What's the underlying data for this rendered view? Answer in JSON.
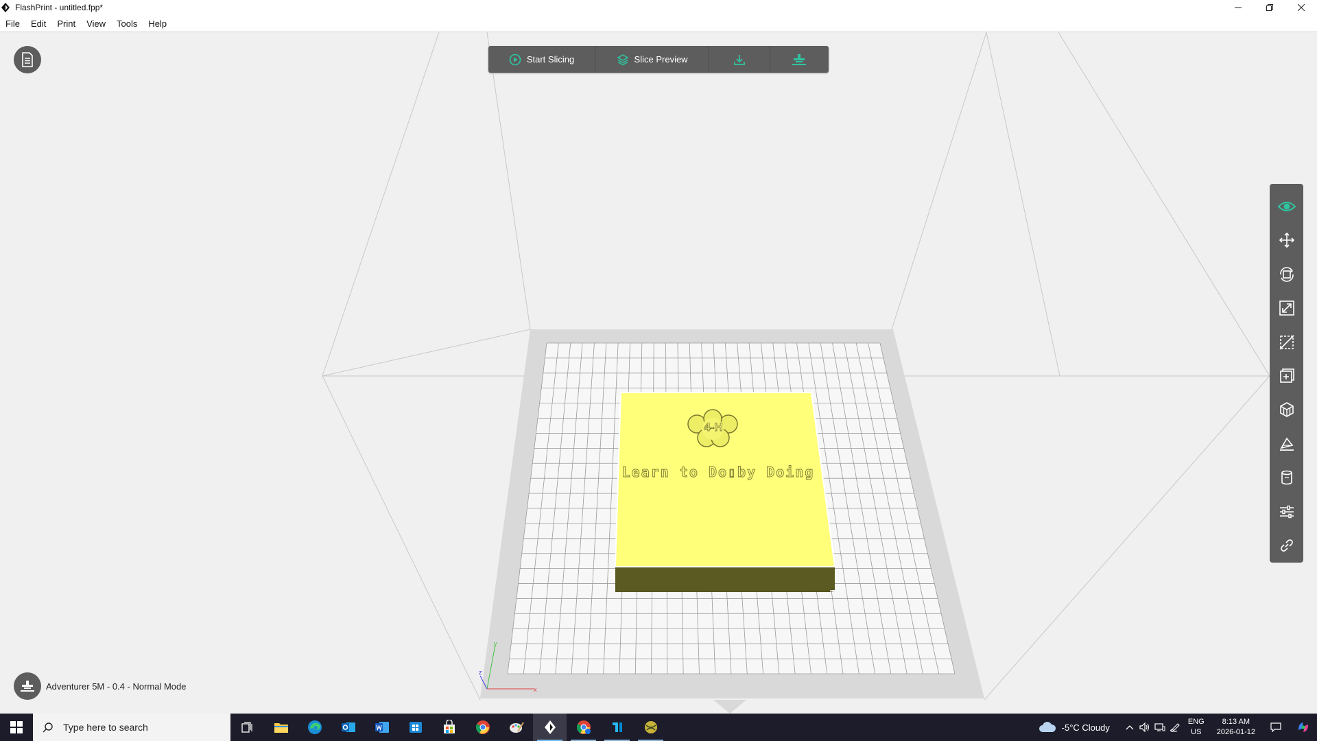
{
  "window": {
    "title": "FlashPrint - untitled.fpp*"
  },
  "menu": [
    "File",
    "Edit",
    "Print",
    "View",
    "Tools",
    "Help"
  ],
  "toolbar": {
    "start_slicing": "Start Slicing",
    "slice_preview": "Slice Preview",
    "export_icon": "download-icon",
    "print_icon": "printer-icon"
  },
  "model": {
    "logo_text": "4-H",
    "engraved_text": "Learn to Do▯by Doing",
    "color": "#ffff7a"
  },
  "status": {
    "printer": "Adventurer 5M - 0.4 - Normal Mode"
  },
  "axes": {
    "x": "x",
    "y": "y",
    "z": "z"
  },
  "right_tools": [
    "eye-icon",
    "move-icon",
    "rotate-icon",
    "scale-icon",
    "cut-icon",
    "add-object-icon",
    "support-icon",
    "lay-flat-icon",
    "cylinder-icon",
    "settings-sliders-icon",
    "link-icon"
  ],
  "taskbar": {
    "search_placeholder": "Type here to search",
    "apps": [
      "task-view-icon",
      "file-explorer-icon",
      "edge-icon",
      "outlook-icon",
      "word-icon",
      "ms-store-icon",
      "store-icon",
      "chrome-icon",
      "paint-icon",
      "flashprint-icon",
      "chrome-profile-icon",
      "tinkercad-icon",
      "globe-app-icon"
    ],
    "weather": "-5°C  Cloudy",
    "lang_top": "ENG",
    "lang_bottom": "US",
    "time": "8:13 AM",
    "date": "2026-01-12"
  },
  "colors": {
    "accent": "#2ec4a0",
    "toolbar_bg": "#5d5d5d",
    "model": "#ffff7a"
  }
}
